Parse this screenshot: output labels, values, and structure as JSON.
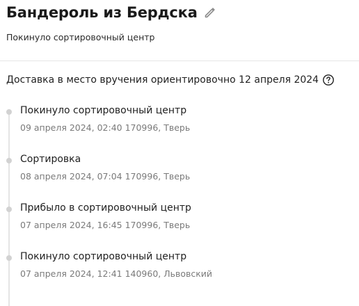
{
  "header": {
    "title": "Бандероль из Бердска",
    "status": "Покинуло сортировочный центр",
    "edit_icon": "pencil-icon"
  },
  "delivery": {
    "text": "Доставка в место вручения ориентировочно 12 апреля 2024",
    "help_icon": "question-circle-icon"
  },
  "events": [
    {
      "title": "Покинуло сортировочный центр",
      "meta": "09 апреля 2024, 02:40 170996, Тверь"
    },
    {
      "title": "Сортировка",
      "meta": "08 апреля 2024, 07:04 170996, Тверь"
    },
    {
      "title": "Прибыло в сортировочный центр",
      "meta": "07 апреля 2024, 16:45 170996, Тверь"
    },
    {
      "title": "Покинуло сортировочный центр",
      "meta": "07 апреля 2024, 12:41 140960, Львовский"
    }
  ],
  "colors": {
    "text_primary": "#1f1f1f",
    "text_secondary": "#7a7a7a",
    "timeline_dot": "#d2d2d2",
    "timeline_line": "#e4e4e4",
    "divider": "#e6e6e6"
  }
}
